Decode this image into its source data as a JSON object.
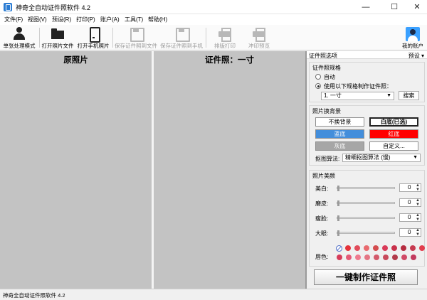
{
  "window": {
    "title": "神奇全自动证件照软件 4.2",
    "min": "—",
    "max": "☐",
    "close": "✕"
  },
  "menu": [
    "文件(F)",
    "视图(V)",
    "预设(R)",
    "打印(P)",
    "账户(A)",
    "工具(T)",
    "帮助(H)"
  ],
  "toolbar": {
    "mode": "单张处理模式",
    "open_file": "打开照片文件",
    "open_phone": "打开手机照片",
    "save_file": "保存证件照到文件",
    "save_phone": "保存证件照到手机",
    "layout_print": "排版打印",
    "print_preview": "冲印预览",
    "account": "我的账户"
  },
  "panes": {
    "original": "原照片",
    "id_photo": "证件照：一寸"
  },
  "right": {
    "header": "证件照选项",
    "preset": "预设 ▾",
    "spec": {
      "title": "证件照规格",
      "auto": "自动",
      "use_spec": "使用以下规格制作证件照：",
      "spec_value": "1. 一寸",
      "search": "搜索",
      "selected": "use_spec"
    },
    "background": {
      "title": "照片换背景",
      "buttons": [
        {
          "label": "不换背景",
          "color": "#ffffff",
          "text_color": "#000000"
        },
        {
          "label": "白底(已选)",
          "color": "#ffffff",
          "text_color": "#000000"
        },
        {
          "label": "蓝底",
          "color": "#438edb",
          "text_color": "#ffffff"
        },
        {
          "label": "红底",
          "color": "#ff0000",
          "text_color": "#ffffff"
        },
        {
          "label": "灰底",
          "color": "#a6a6a6",
          "text_color": "#ffffff"
        },
        {
          "label": "自定义...",
          "color": "#ffffff",
          "text_color": "#000000"
        }
      ],
      "algo_label": "抠图算法:",
      "algo_value": "精细抠图算法 (慢)"
    },
    "beauty": {
      "title": "照片美颜",
      "sliders": [
        {
          "label": "美白:",
          "value": "0"
        },
        {
          "label": "磨皮:",
          "value": "0"
        },
        {
          "label": "瘦脸:",
          "value": "0"
        },
        {
          "label": "大眼:",
          "value": "0"
        }
      ],
      "lip_label": "唇色:",
      "lip_colors": [
        "#e5323a",
        "#e14b5a",
        "#e96a6e",
        "#d44c4e",
        "#d93a58",
        "#c8304a",
        "#b52a3e",
        "#c73a50",
        "#e23d4d",
        "#d63c5a",
        "#e55a78",
        "#ef7a8e",
        "#e47684",
        "#d35a6b",
        "#c84a5c",
        "#b23a4a",
        "#d04a66",
        "#c23a5e"
      ]
    },
    "make_button": "一键制作证件照"
  },
  "status": "神奇全自动证件照软件 4.2"
}
